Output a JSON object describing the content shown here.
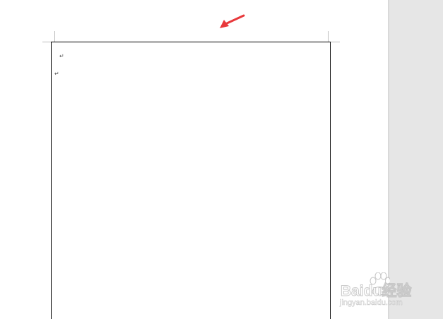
{
  "document": {
    "paragraph_mark": "↵"
  },
  "annotation": {
    "arrow_color": "#e8383b"
  },
  "watermark": {
    "brand_text": "Baidu经验",
    "url_text": "jingyan.baidu.com"
  },
  "colors": {
    "workspace_background": "#ffffff",
    "side_pane_background": "#e6e6e6",
    "page_border": "#000000"
  }
}
